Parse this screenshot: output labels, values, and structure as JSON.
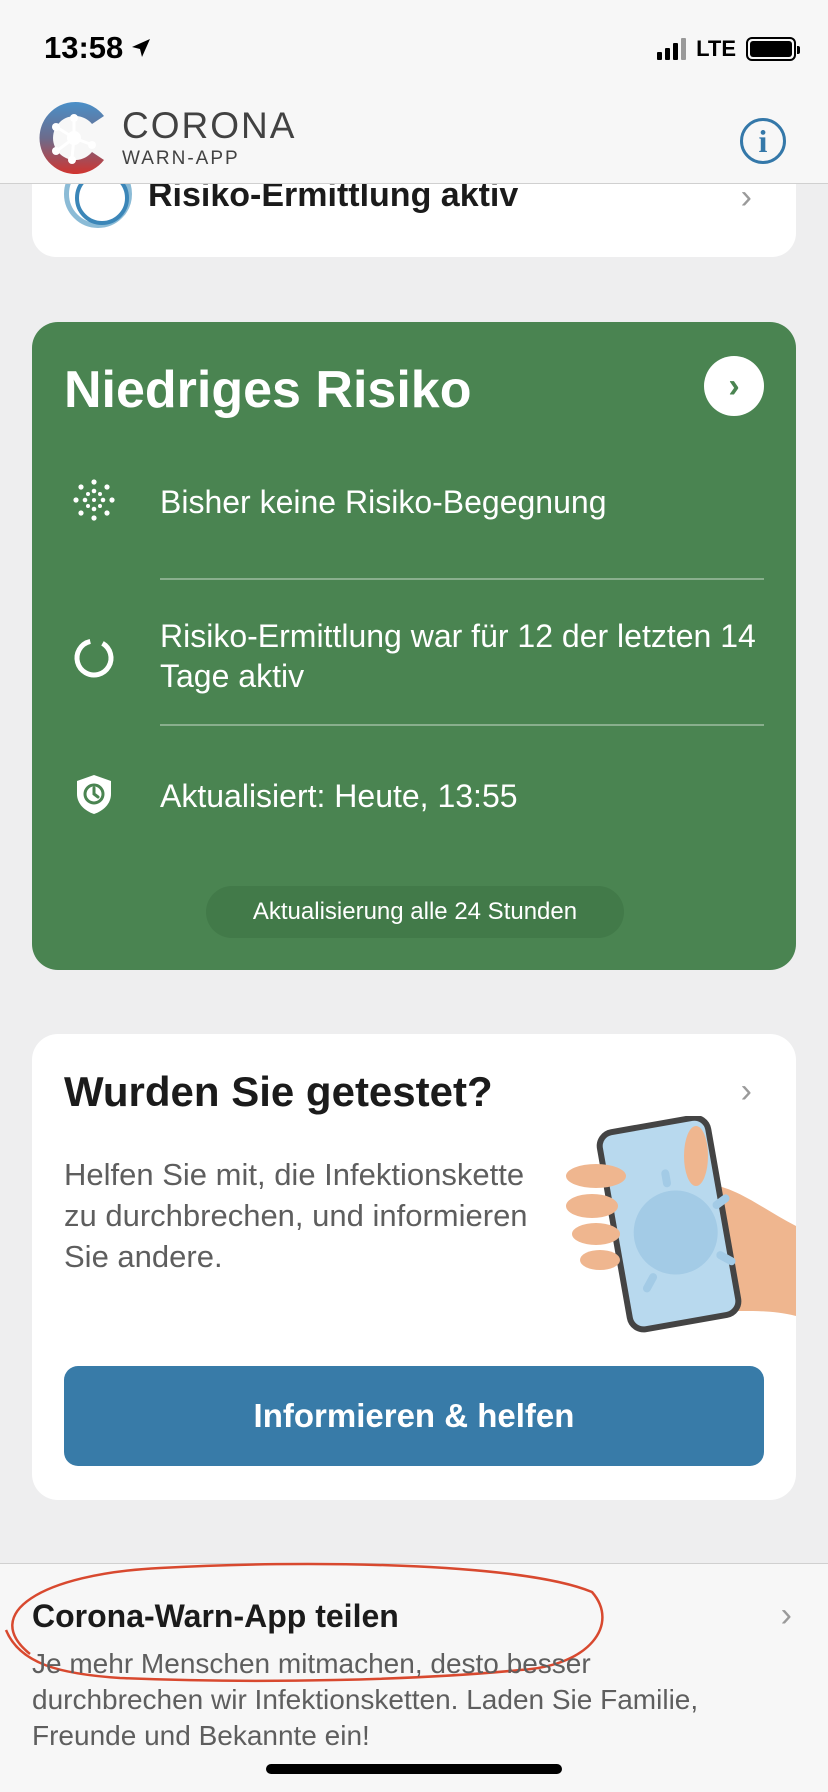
{
  "status_bar": {
    "time": "13:58",
    "network": "LTE",
    "icons": [
      "location-arrow-icon",
      "signal-icon",
      "battery-icon"
    ]
  },
  "header": {
    "logo_line1": "CORONA",
    "logo_line2": "WARN-APP",
    "info_icon": "i"
  },
  "tracing_card": {
    "label": "Risiko-Ermittlung aktiv"
  },
  "risk_card": {
    "title": "Niedriges Risiko",
    "color": "#4a8451",
    "rows": [
      {
        "icon": "virus-dots-icon",
        "text": "Bisher keine Risiko-Begegnung"
      },
      {
        "icon": "progress-ring-icon",
        "text": "Risiko-Ermittlung war für 12 der letzten 14 Tage aktiv"
      },
      {
        "icon": "shield-clock-icon",
        "text": "Aktualisiert: Heute, 13:55"
      }
    ],
    "update_interval": "Aktualisierung alle 24 Stunden"
  },
  "test_card": {
    "title": "Wurden Sie getestet?",
    "description": "Helfen Sie mit, die Infektionskette zu durchbrechen, und informieren Sie andere.",
    "button_label": "Informieren & helfen",
    "accent": "#387ba8"
  },
  "share_row": {
    "title": "Corona-Warn-App teilen",
    "description": "Je mehr Menschen mitmachen, desto besser durchbrechen wir Infektionsketten. Laden Sie Familie, Freunde und Bekannte ein!"
  }
}
